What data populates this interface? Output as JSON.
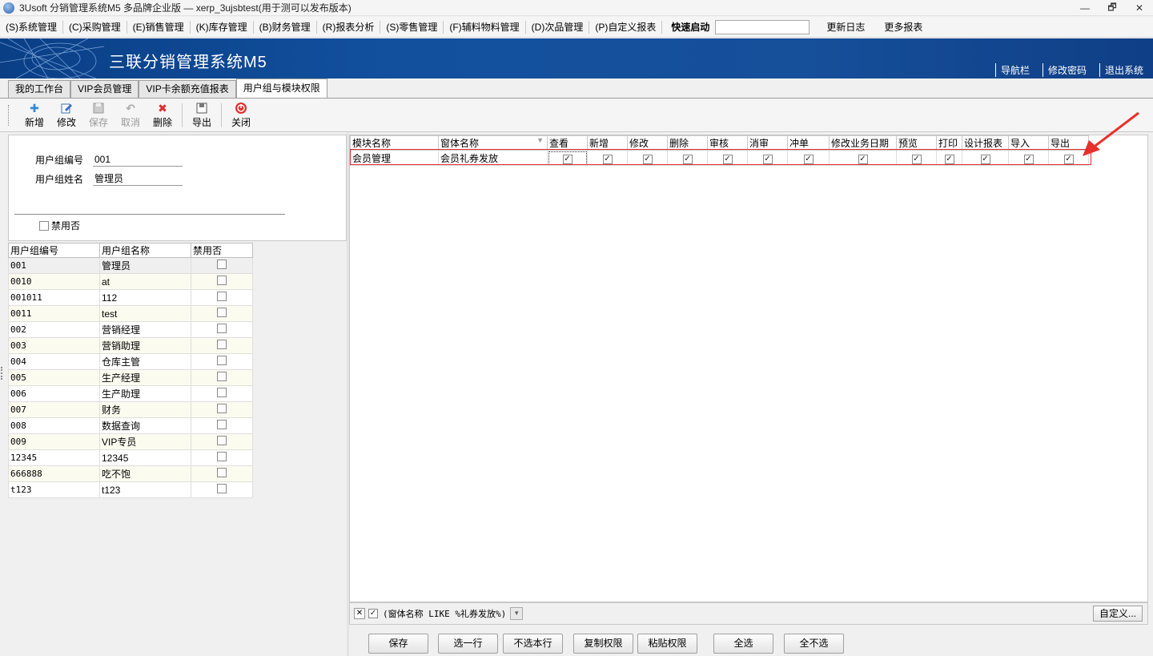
{
  "window": {
    "title": "3Usoft 分销管理系统M5 多品牌企业版 — xerp_3ujsbtest(用于测可以发布版本)",
    "controls": [
      "—",
      "🗗",
      "✕"
    ]
  },
  "menu": {
    "items": [
      "(S)系统管理",
      "(C)采购管理",
      "(E)销售管理",
      "(K)库存管理",
      "(B)财务管理",
      "(R)报表分析",
      "(S)零售管理",
      "(F)辅料物料管理",
      "(D)次品管理",
      "(P)自定义报表"
    ],
    "quick_label": "快速启动",
    "quick_value": "",
    "right_items": [
      "更新日志",
      "更多报表"
    ]
  },
  "banner": {
    "title": "三联分销管理系统M5",
    "links": [
      "导航栏",
      "修改密码",
      "退出系统"
    ]
  },
  "tabs": [
    "我的工作台",
    "VIP会员管理",
    "VIP卡余额充值报表",
    "用户组与模块权限"
  ],
  "active_tab": 3,
  "toolbar": {
    "buttons": [
      {
        "label": "新增",
        "icon": "plus-icon",
        "enabled": true
      },
      {
        "label": "修改",
        "icon": "edit-icon",
        "enabled": true
      },
      {
        "label": "保存",
        "icon": "save-icon",
        "enabled": false
      },
      {
        "label": "取消",
        "icon": "undo-icon",
        "enabled": false
      },
      {
        "label": "删除",
        "icon": "delete-icon",
        "enabled": true
      },
      {
        "label": "导出",
        "icon": "export-icon",
        "enabled": true
      },
      {
        "label": "关闭",
        "icon": "close-icon",
        "enabled": true
      }
    ]
  },
  "form": {
    "code_label": "用户组编号",
    "code_value": "001",
    "name_label": "用户组姓名",
    "name_value": "管理员",
    "disabled_label": "禁用否"
  },
  "left_grid": {
    "columns": [
      "用户组编号",
      "用户组名称",
      "禁用否"
    ],
    "rows": [
      {
        "code": "001",
        "name": "管理员",
        "disabled": false
      },
      {
        "code": "0010",
        "name": "at",
        "disabled": false
      },
      {
        "code": "001011",
        "name": "112",
        "disabled": false
      },
      {
        "code": "0011",
        "name": "test",
        "disabled": false
      },
      {
        "code": "002",
        "name": "营销经理",
        "disabled": false
      },
      {
        "code": "003",
        "name": "营销助理",
        "disabled": false
      },
      {
        "code": "004",
        "name": "仓库主管",
        "disabled": false
      },
      {
        "code": "005",
        "name": "生产经理",
        "disabled": false
      },
      {
        "code": "006",
        "name": "生产助理",
        "disabled": false
      },
      {
        "code": "007",
        "name": "财务",
        "disabled": false
      },
      {
        "code": "008",
        "name": "数据查询",
        "disabled": false
      },
      {
        "code": "009",
        "name": "VIP专员",
        "disabled": false
      },
      {
        "code": "12345",
        "name": "12345",
        "disabled": false
      },
      {
        "code": "666888",
        "name": "吃不饱",
        "disabled": false
      },
      {
        "code": "t123",
        "name": "t123",
        "disabled": false
      }
    ]
  },
  "right_grid": {
    "columns": [
      "模块名称",
      "窗体名称",
      "查看",
      "新增",
      "修改",
      "删除",
      "审核",
      "消审",
      "冲单",
      "修改业务日期",
      "预览",
      "打印",
      "设计报表",
      "导入",
      "导出"
    ],
    "rows": [
      {
        "module": "会员管理",
        "form": "会员礼券发放",
        "perms": [
          true,
          true,
          true,
          true,
          true,
          true,
          true,
          true,
          true,
          true,
          true,
          true,
          true
        ]
      }
    ]
  },
  "filter": {
    "enabled": true,
    "text": "(窗体名称 LIKE %礼券发放%)",
    "custom_label": "自定义..."
  },
  "bottom_buttons": [
    "保存",
    "选一行",
    "不选本行",
    "复制权限",
    "粘贴权限",
    "全选",
    "全不选"
  ],
  "colors": {
    "banner": "#12509e",
    "highlight": "#e03030"
  }
}
